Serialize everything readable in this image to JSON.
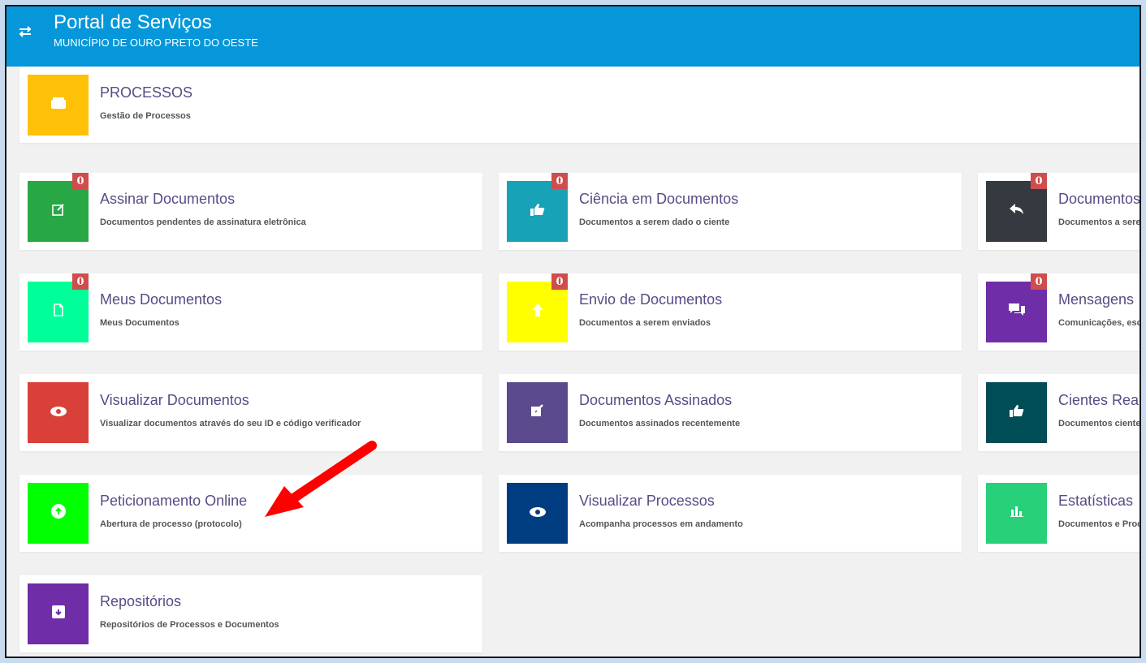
{
  "header": {
    "title": "Portal de Serviços",
    "subtitle": "MUNICÍPIO DE OURO PRETO DO OESTE",
    "toggle_icon": "swap-arrows-icon"
  },
  "top_card": {
    "title": "PROCESSOS",
    "desc": "Gestão de Processos",
    "color": "#ffc107",
    "icon": "folder-icon"
  },
  "cards": [
    {
      "title": "Assinar Documentos",
      "desc": "Documentos pendentes de assinatura eletrônica",
      "badge": "0",
      "color": "#28a745",
      "icon": "edit-icon"
    },
    {
      "title": "Ciência em Documentos",
      "desc": "Documentos a serem dado o ciente",
      "badge": "0",
      "color": "#17a2b8",
      "icon": "thumbs-up-icon"
    },
    {
      "title": "Documentos",
      "desc": "Documentos a sere",
      "badge": "0",
      "color": "#343a40",
      "icon": "reply-icon"
    },
    {
      "title": "Meus Documentos",
      "desc": "Meus Documentos",
      "badge": "0",
      "color": "#00ff99",
      "icon": "file-icon"
    },
    {
      "title": "Envio de Documentos",
      "desc": "Documentos a serem enviados",
      "badge": "0",
      "color": "#ffff00",
      "icon": "upload-arrow-icon"
    },
    {
      "title": "Mensagens",
      "desc": "Comunicações, esc",
      "badge": "0",
      "color": "#6f2da8",
      "icon": "chat-icon"
    },
    {
      "title": "Visualizar Documentos",
      "desc": "Visualizar documentos através do seu ID e código verificador",
      "color": "#d9403a",
      "icon": "eye-icon"
    },
    {
      "title": "Documentos Assinados",
      "desc": "Documentos assinados recentemente",
      "color": "#5b4a8e",
      "icon": "signed-edit-icon"
    },
    {
      "title": "Cientes Rea",
      "desc": "Documentos ciente",
      "color": "#004d55",
      "icon": "thumbs-up-icon"
    },
    {
      "title": "Peticionamento Online",
      "desc": "Abertura de processo (protocolo)",
      "color": "#00ff00",
      "icon": "cloud-upload-icon"
    },
    {
      "title": "Visualizar Processos",
      "desc": "Acompanha processos em andamento",
      "color": "#003d80",
      "icon": "eye-icon"
    },
    {
      "title": "Estatísticas",
      "desc": "Documentos e Proc",
      "color": "#28d07a",
      "icon": "bar-chart-icon"
    },
    {
      "title": "Repositórios",
      "desc": "Repositórios de Processos e Documentos",
      "color": "#6f2da8",
      "icon": "archive-icon"
    }
  ]
}
